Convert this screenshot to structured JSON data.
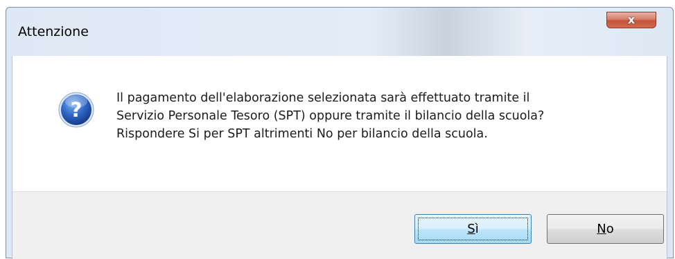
{
  "dialog": {
    "title": "Attenzione",
    "close_label": "x",
    "icon": "question-icon",
    "message_lines": [
      "Il pagamento dell'elaborazione selezionata sarà effettuato tramite il",
      "Servizio Personale Tesoro (SPT) oppure tramite il bilancio della scuola?",
      "Rispondere Si per SPT altrimenti No per bilancio della scuola."
    ],
    "buttons": {
      "yes": {
        "accel": "S",
        "rest": "ì"
      },
      "no": {
        "accel": "N",
        "rest": "o"
      }
    }
  },
  "colors": {
    "titlebar": "#dfe9f5",
    "close_button": "#c4533c",
    "default_button": "#bee6fd",
    "button_area": "#f0f0f0"
  }
}
